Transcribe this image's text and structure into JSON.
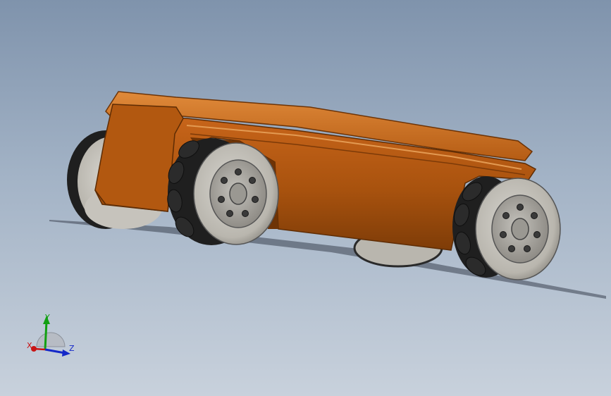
{
  "viewport": {
    "background_top": "#7f93ac",
    "background_bottom": "#c8d1dc"
  },
  "model": {
    "body_color": "#b85a10",
    "body_shadow": "#7c3a08",
    "tire_color": "#c9c7c1",
    "roller_color": "#1f1f1f",
    "hub_color": "#a9a7a2"
  },
  "triad": {
    "x_label": "X",
    "y_label": "Y",
    "z_label": "Z",
    "x_color": "#c81414",
    "y_color": "#12a012",
    "z_color": "#1428c8"
  }
}
